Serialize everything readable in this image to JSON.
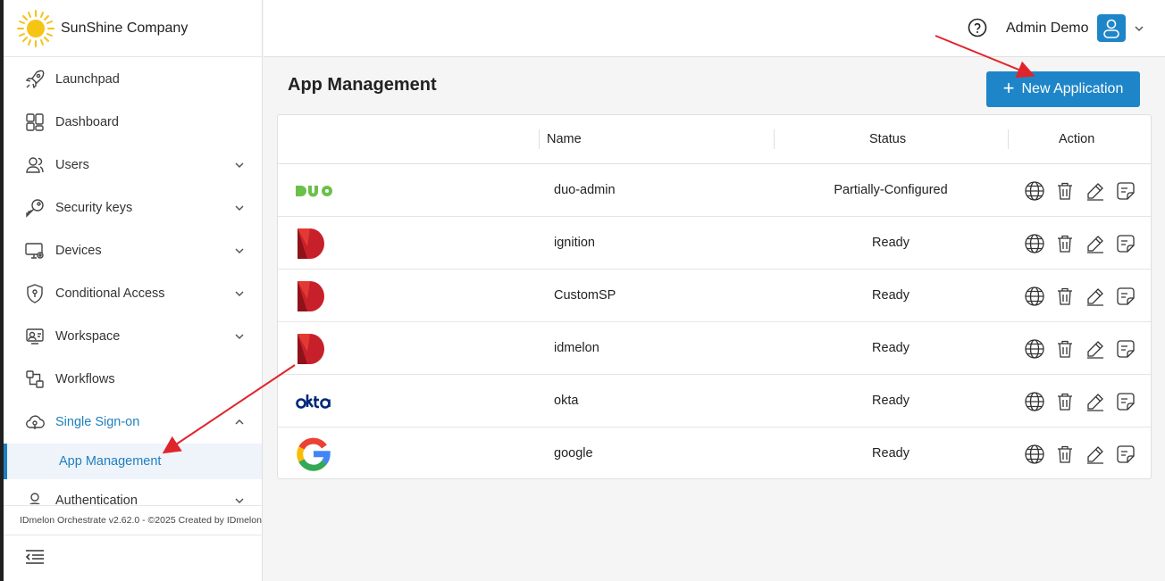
{
  "brand": {
    "name": "SunShine Company",
    "logo_icon": "sun-icon"
  },
  "sidebar": {
    "items": [
      {
        "label": "Launchpad",
        "icon": "rocket-icon",
        "expandable": false
      },
      {
        "label": "Dashboard",
        "icon": "dashboard-icon",
        "expandable": false
      },
      {
        "label": "Users",
        "icon": "users-icon",
        "expandable": true
      },
      {
        "label": "Security keys",
        "icon": "key-icon",
        "expandable": true
      },
      {
        "label": "Devices",
        "icon": "devices-icon",
        "expandable": true
      },
      {
        "label": "Conditional Access",
        "icon": "shield-icon",
        "expandable": true
      },
      {
        "label": "Workspace",
        "icon": "workspace-icon",
        "expandable": true
      },
      {
        "label": "Workflows",
        "icon": "workflow-icon",
        "expandable": false
      },
      {
        "label": "Single Sign-on",
        "icon": "cloud-icon",
        "expandable": true,
        "expanded": true
      },
      {
        "label": "Authentication",
        "icon": "authentication-icon",
        "expandable": true
      }
    ],
    "active_subitem": "App Management",
    "footer": "IDmelon Orchestrate v2.62.0 - ©2025 Created by IDmelon"
  },
  "header": {
    "user_name": "Admin Demo",
    "help_icon": "help-icon",
    "avatar_icon": "user-icon"
  },
  "page": {
    "title": "App Management",
    "new_button_label": "New Application"
  },
  "table": {
    "columns": [
      "Name",
      "Status",
      "Action"
    ],
    "rows": [
      {
        "logo": "duo-logo",
        "name": "duo-admin",
        "status": "Partially-Configured"
      },
      {
        "logo": "idmelon-logo",
        "name": "ignition",
        "status": "Ready"
      },
      {
        "logo": "idmelon-logo",
        "name": "CustomSP",
        "status": "Ready"
      },
      {
        "logo": "idmelon-logo",
        "name": "idmelon",
        "status": "Ready"
      },
      {
        "logo": "okta-logo",
        "name": "okta",
        "status": "Ready"
      },
      {
        "logo": "google-logo",
        "name": "google",
        "status": "Ready"
      }
    ],
    "action_icons": [
      "globe-icon",
      "trash-icon",
      "edit-icon",
      "document-icon"
    ]
  },
  "colors": {
    "accent": "#1e86c8",
    "annotation_arrow": "#e0242b",
    "idmelon_red": "#c8202a",
    "okta_navy": "#00297a",
    "duo_green": "#6bc04b"
  }
}
